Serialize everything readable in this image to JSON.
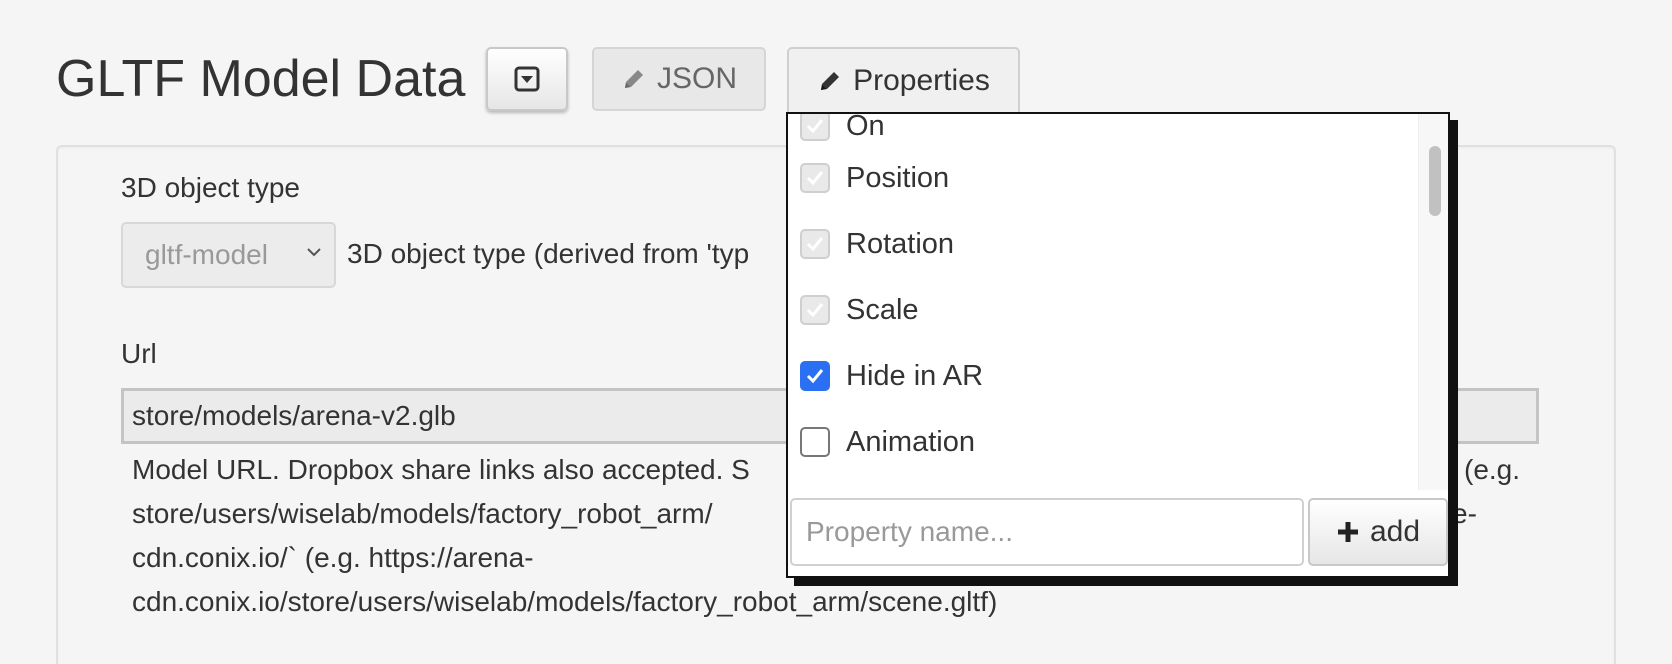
{
  "header": {
    "title": "GLTF Model Data",
    "json_label": "JSON",
    "properties_label": "Properties"
  },
  "form": {
    "type_label": "3D object type",
    "type_value": "gltf-model",
    "type_help": "3D object type (derived from 'typ",
    "url_label": "Url",
    "url_value": "store/models/arena-v2.glb",
    "url_help_lines": [
      "Model URL. Dropbox share links also accepted. S",
      "store/users/wiselab/models/factory_robot_arm/",
      "cdn.conix.io/` (e.g. https://arena-",
      "cdn.conix.io/store/users/wiselab/models/factory_robot_arm/scene.gltf)"
    ],
    "url_help_tail_1": "(e.g.",
    "url_help_tail_2": "e-"
  },
  "properties_popup": {
    "items": [
      {
        "label": "On",
        "state": "checked-disabled"
      },
      {
        "label": "Position",
        "state": "checked-disabled"
      },
      {
        "label": "Rotation",
        "state": "checked-disabled"
      },
      {
        "label": "Scale",
        "state": "checked-disabled"
      },
      {
        "label": "Hide in AR",
        "state": "checked"
      },
      {
        "label": "Animation",
        "state": "unchecked"
      }
    ],
    "input_placeholder": "Property name...",
    "add_label": "add"
  },
  "colors": {
    "accent": "#2b6ff3",
    "background": "#f5f5f5"
  }
}
